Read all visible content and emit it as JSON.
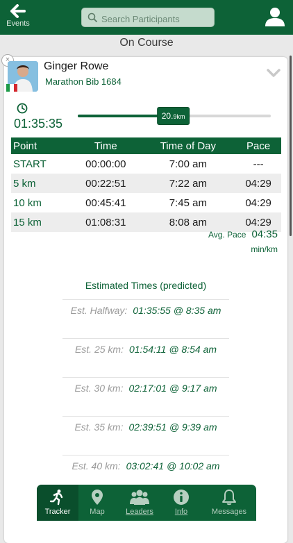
{
  "header": {
    "back_label": "Events",
    "search_placeholder": "Search Participants"
  },
  "section_title": "On Course",
  "participant": {
    "name": "Ginger Rowe",
    "bib": "Marathon Bib 1684",
    "flag_colors": [
      "#1e9a48",
      "#ffffff",
      "#d4282e"
    ],
    "elapsed": "01:35:35",
    "distance_value": "20.",
    "distance_unit": "9km",
    "progress_fraction": 0.495
  },
  "splits": {
    "headers": [
      "Point",
      "Time",
      "Time of Day",
      "Pace"
    ],
    "rows": [
      [
        "START",
        "00:00:00",
        "7:00 am",
        "---"
      ],
      [
        "5 km",
        "00:22:51",
        "7:22 am",
        "04:29"
      ],
      [
        "10 km",
        "00:45:41",
        "7:45 am",
        "04:29"
      ],
      [
        "15 km",
        "01:08:31",
        "8:08 am",
        "04:29"
      ]
    ]
  },
  "avg_pace": {
    "label": "Avg. Pace",
    "value": "04:35",
    "unit": "min/km"
  },
  "estimates": {
    "title": "Estimated Times (predicted)",
    "items": [
      {
        "label": "Est. Halfway:",
        "value": "01:35:55 @ 8:35 am"
      },
      {
        "label": "Est. 25 km:",
        "value": "01:54:11 @ 8:54 am"
      },
      {
        "label": "Est. 30 km:",
        "value": "02:17:01 @ 9:17 am"
      },
      {
        "label": "Est. 35 km:",
        "value": "02:39:51 @ 9:39 am"
      },
      {
        "label": "Est. 40 km:",
        "value": "03:02:41 @ 10:02 am"
      }
    ]
  },
  "tabs": [
    {
      "label": "Tracker",
      "icon": "runner-icon"
    },
    {
      "label": "Map",
      "icon": "map-pin-icon"
    },
    {
      "label": "Leaders",
      "icon": "group-icon"
    },
    {
      "label": "Info",
      "icon": "info-icon"
    },
    {
      "label": "Messages",
      "icon": "bell-icon"
    }
  ],
  "colors": {
    "brand": "#0d6237",
    "muted": "#9a9a9a"
  }
}
